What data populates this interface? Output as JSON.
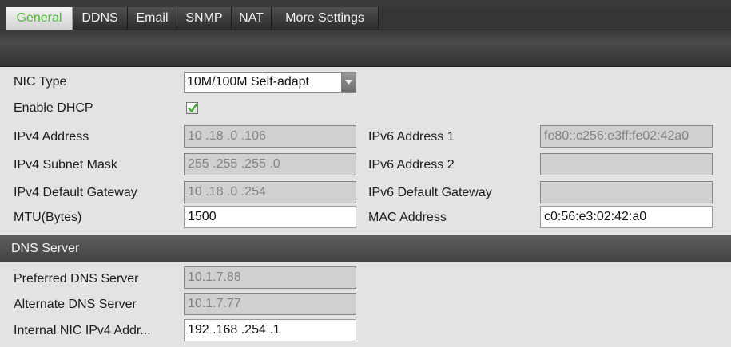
{
  "tabs": [
    {
      "label": "General",
      "active": true
    },
    {
      "label": "DDNS",
      "active": false
    },
    {
      "label": "Email",
      "active": false
    },
    {
      "label": "SNMP",
      "active": false
    },
    {
      "label": "NAT",
      "active": false
    },
    {
      "label": "More Settings",
      "active": false
    }
  ],
  "form": {
    "nic_type_label": "NIC Type",
    "nic_type_value": "10M/100M Self-adapt",
    "enable_dhcp_label": "Enable DHCP",
    "enable_dhcp_checked": true,
    "ipv4_address_label": "IPv4 Address",
    "ipv4_address_value": "10  .18  .0  .106",
    "ipv4_subnet_label": "IPv4 Subnet Mask",
    "ipv4_subnet_value": "255 .255 .255 .0",
    "ipv4_gateway_label": "IPv4 Default Gateway",
    "ipv4_gateway_value": "10  .18  .0  .254",
    "mtu_label": "MTU(Bytes)",
    "mtu_value": "1500",
    "ipv6_address1_label": "IPv6 Address 1",
    "ipv6_address1_value": "fe80::c256:e3ff:fe02:42a0",
    "ipv6_address2_label": "IPv6 Address 2",
    "ipv6_address2_value": "",
    "ipv6_gateway_label": "IPv6 Default Gateway",
    "ipv6_gateway_value": "",
    "mac_address_label": "MAC Address",
    "mac_address_value": "c0:56:e3:02:42:a0"
  },
  "dns": {
    "section_title": "DNS Server",
    "preferred_label": "Preferred DNS Server",
    "preferred_value": "10.1.7.88",
    "alternate_label": "Alternate DNS Server",
    "alternate_value": "10.1.7.77",
    "internal_nic_label": "Internal NIC IPv4 Addr...",
    "internal_nic_value": "192 .168 .254 .1"
  },
  "colors": {
    "active_tab_text": "#55b53c",
    "checkmark": "#4aa83a"
  },
  "icons": {
    "dropdown": "chevron-down-icon",
    "checkbox": "checkmark-icon"
  }
}
